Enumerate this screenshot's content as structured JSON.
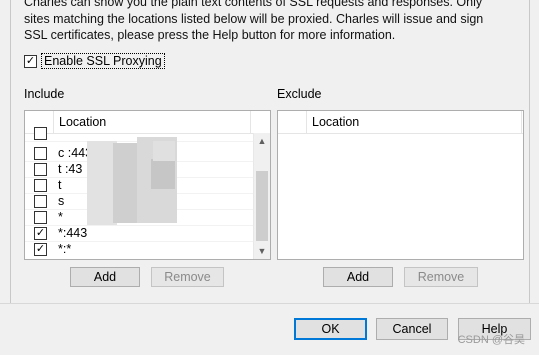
{
  "description": {
    "line1": "Charles can show you the plain text contents of SSL requests and responses. Only",
    "line2": "sites matching the locations listed below will be proxied. Charles will issue and sign",
    "line3": "SSL certificates, please press the Help button for more information."
  },
  "enable_ssl": {
    "label": "Enable SSL Proxying",
    "checked_mark": "✓"
  },
  "include": {
    "label": "Include",
    "column": "Location",
    "rows": [
      {
        "checked": "",
        "location": ""
      },
      {
        "checked": "",
        "location": "c                               :443"
      },
      {
        "checked": "",
        "location": "t                               :43"
      },
      {
        "checked": "",
        "location": "t"
      },
      {
        "checked": "",
        "location": "s"
      },
      {
        "checked": "",
        "location": "*"
      },
      {
        "checked": "✓",
        "location": "*:443"
      },
      {
        "checked": "✓",
        "location": "*:*"
      }
    ],
    "add_label": "Add",
    "remove_label": "Remove"
  },
  "exclude": {
    "label": "Exclude",
    "column": "Location",
    "add_label": "Add",
    "remove_label": "Remove"
  },
  "footer": {
    "ok_label": "OK",
    "cancel_label": "Cancel",
    "help_label": "Help"
  },
  "watermark": "CSDN @谷昊"
}
